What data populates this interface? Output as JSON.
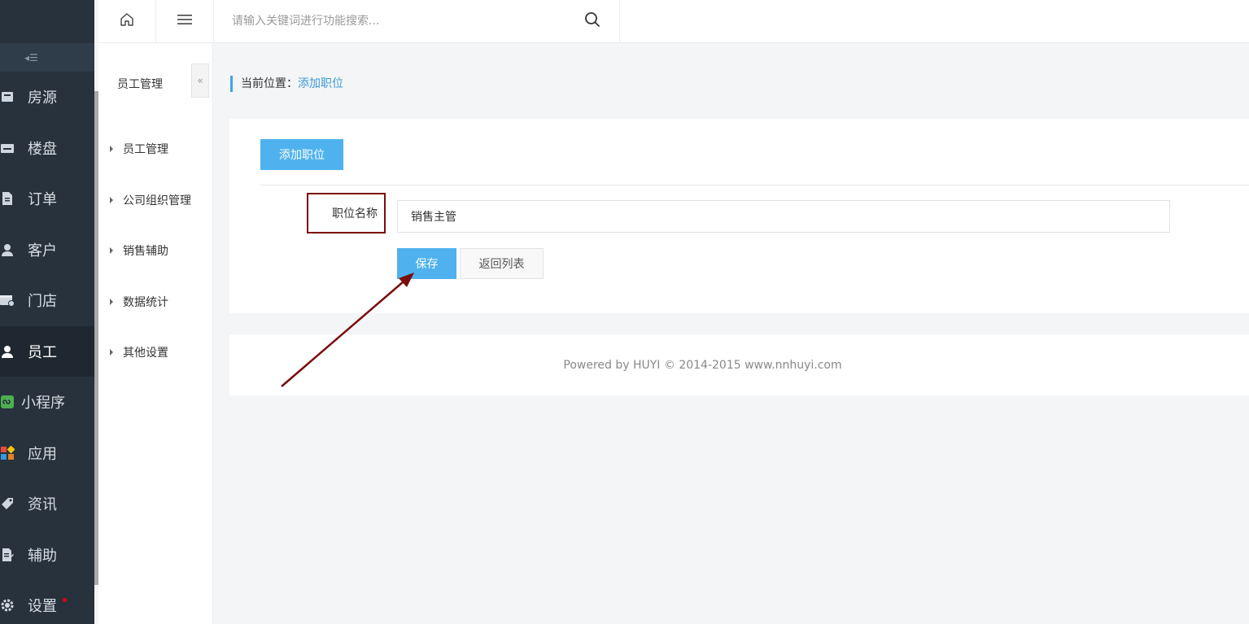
{
  "sidebar": {
    "items": [
      {
        "label": "房源",
        "icon": "house-icon"
      },
      {
        "label": "楼盘",
        "icon": "building-icon"
      },
      {
        "label": "订单",
        "icon": "document-icon"
      },
      {
        "label": "客户",
        "icon": "user-icon"
      },
      {
        "label": "门店",
        "icon": "store-icon"
      },
      {
        "label": "员工",
        "icon": "person-icon",
        "active": true
      },
      {
        "label": "小程序",
        "icon": "mini-program-icon"
      },
      {
        "label": "应用",
        "icon": "apps-icon"
      },
      {
        "label": "资讯",
        "icon": "tag-icon"
      },
      {
        "label": "辅助",
        "icon": "edit-doc-icon"
      },
      {
        "label": "设置",
        "icon": "gear-icon",
        "badge": true
      }
    ]
  },
  "topbar": {
    "search_placeholder": "请输入关键词进行功能搜索..."
  },
  "subnav": {
    "title": "员工管理",
    "items": [
      "员工管理",
      "公司组织管理",
      "销售辅助",
      "数据统计",
      "其他设置"
    ]
  },
  "breadcrumb": {
    "prefix": "当前位置：",
    "current": "添加职位"
  },
  "form": {
    "add_button": "添加职位",
    "field_label": "职位名称",
    "field_value": "销售主管",
    "save_button": "保存",
    "back_button": "返回列表"
  },
  "footer": {
    "text": "Powered by HUYI © 2014-2015 www.nnhuyi.com"
  },
  "colors": {
    "accent": "#4fb2ef",
    "sidebar_bg": "#27323d",
    "annotation": "#7a0c0c"
  }
}
